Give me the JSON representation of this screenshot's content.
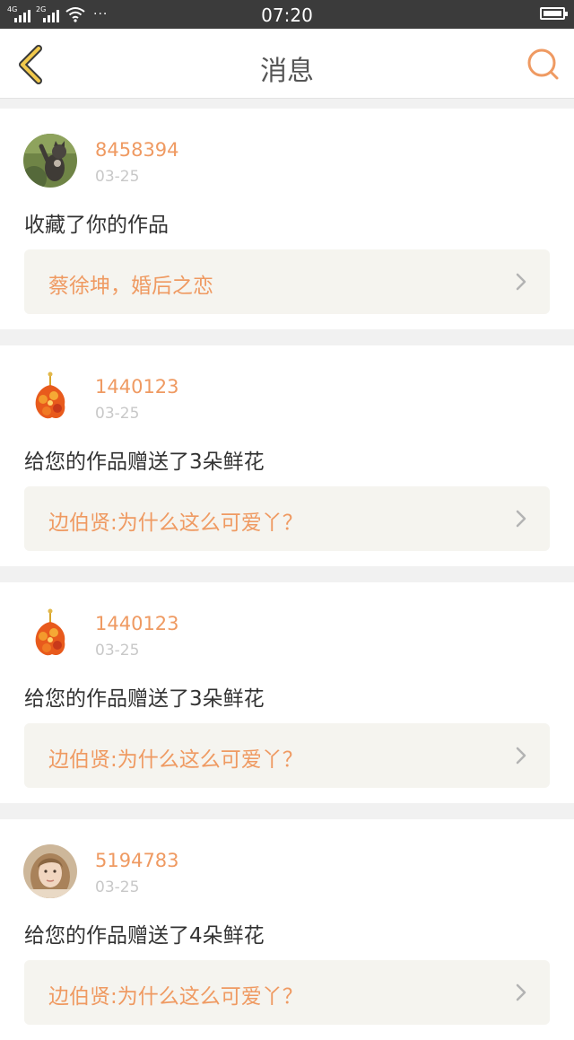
{
  "status_bar": {
    "network_1": "4G",
    "network_2": "2G",
    "overflow": "···",
    "time": "07:20"
  },
  "header": {
    "back_icon": "chevron-left-icon",
    "title": "消息",
    "search_icon": "search-icon"
  },
  "colors": {
    "accent": "#ef9a62",
    "back_icon": "#f2c94c",
    "date": "#c8c8c8",
    "link_bg": "#f5f4ef",
    "page_bg": "#f1f1f1"
  },
  "notifications": [
    {
      "username": "8458394",
      "date": "03-25",
      "action": "收藏了你的作品",
      "work_title": "蔡徐坤，婚后之恋",
      "avatar": "cat-avatar"
    },
    {
      "username": "1440123",
      "date": "03-25",
      "action": "给您的作品赠送了3朵鲜花",
      "work_title": "边伯贤:为什么这么可爱丫？",
      "avatar": "flower-avatar"
    },
    {
      "username": "1440123",
      "date": "03-25",
      "action": "给您的作品赠送了3朵鲜花",
      "work_title": "边伯贤:为什么这么可爱丫？",
      "avatar": "flower-avatar"
    },
    {
      "username": "5194783",
      "date": "03-25",
      "action": "给您的作品赠送了4朵鲜花",
      "work_title": "边伯贤:为什么这么可爱丫？",
      "avatar": "girl-avatar"
    }
  ]
}
